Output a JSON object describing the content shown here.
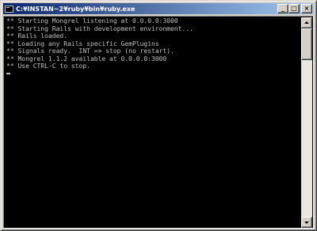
{
  "window": {
    "title": "C:¥INSTAN~2¥ruby¥bin¥ruby.exe",
    "controls": {
      "minimize": "_",
      "maximize": "□",
      "close": "×"
    }
  },
  "console": {
    "lines": [
      "** Starting Mongrel listening at 0.0.0.0:3000",
      "** Starting Rails with development environment...",
      "** Rails loaded.",
      "** Loading any Rails specific GemPlugins",
      "** Signals ready.  INT => stop (no restart).",
      "** Mongrel 1.1.2 available at 0.0.0.0:3000",
      "** Use CTRL-C to stop."
    ]
  },
  "colors": {
    "console_background": "#000000",
    "console_text": "#c0c0c0",
    "titlebar_start": "#0a246a",
    "titlebar_end": "#a6caf0"
  },
  "icons": {
    "app": "console-app-icon",
    "scroll_up": "arrow-up-icon",
    "scroll_down": "arrow-down-icon"
  }
}
